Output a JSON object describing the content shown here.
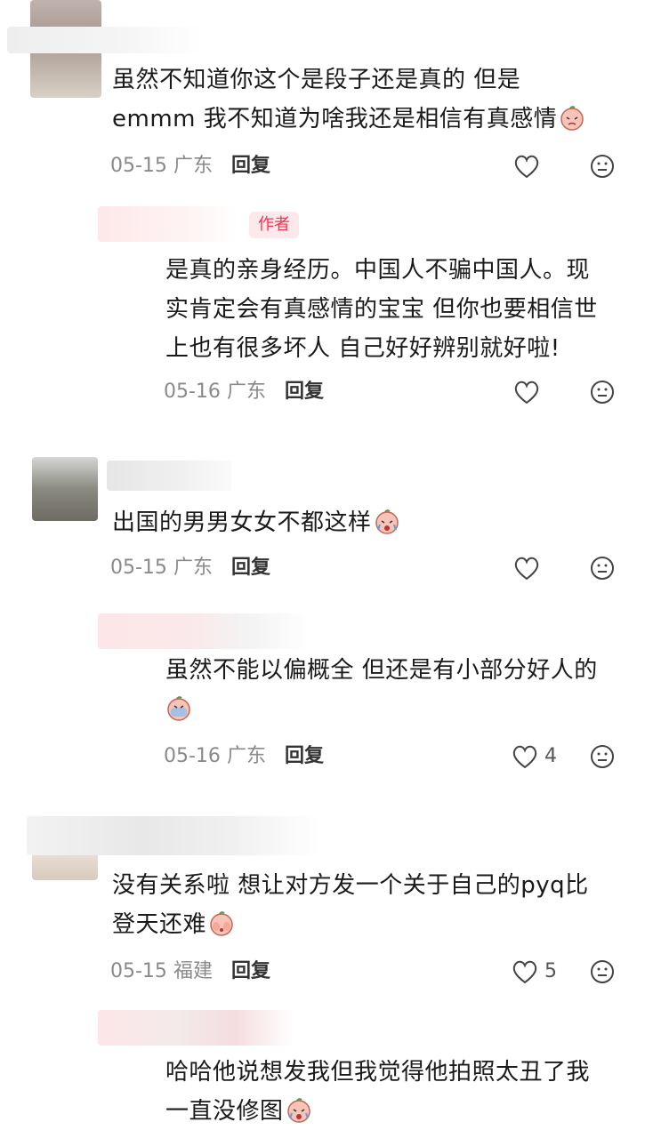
{
  "comments": [
    {
      "text1": "虽然不知道你这个是段子还是真的 但是",
      "text2": "emmm 我不知道为啥我还是相信有真感情",
      "date": "05-15",
      "region": "广东",
      "reply_label": "回复",
      "emoji": "crying-peach-emoji"
    },
    {
      "author_tag": "作者",
      "text1": "是真的亲身经历。中国人不骗中国人。现",
      "text2": "实肯定会有真感情的宝宝 但你也要相信世",
      "text3": "上也有很多坏人 自己好好辨别就好啦!",
      "date": "05-16",
      "region": "广东",
      "reply_label": "回复"
    },
    {
      "text1": "出国的男男女女不都这样",
      "date": "05-15",
      "region": "广东",
      "reply_label": "回复",
      "emoji": "crying-peach-emoji"
    },
    {
      "text1": "虽然不能以偏概全 但还是有小部分好人的",
      "date": "05-16",
      "region": "广东",
      "reply_label": "回复",
      "likes": "4",
      "emoji": "crying-peach-emoji"
    },
    {
      "text1": "没有关系啦 想让对方发一个关于自己的pyq比",
      "text2": "登天还难",
      "date": "05-15",
      "region": "福建",
      "reply_label": "回复",
      "likes": "5",
      "emoji": "covering-face-peach-emoji"
    },
    {
      "text1": "哈哈他说想发我但我觉得他拍照太丑了我",
      "text2": "一直没修图",
      "emoji": "crying-peach-emoji"
    }
  ],
  "colors": {
    "author_tag_bg": "#fde9ec",
    "author_tag_text": "#ff2e4d",
    "meta_text": "#8a8a8a"
  }
}
